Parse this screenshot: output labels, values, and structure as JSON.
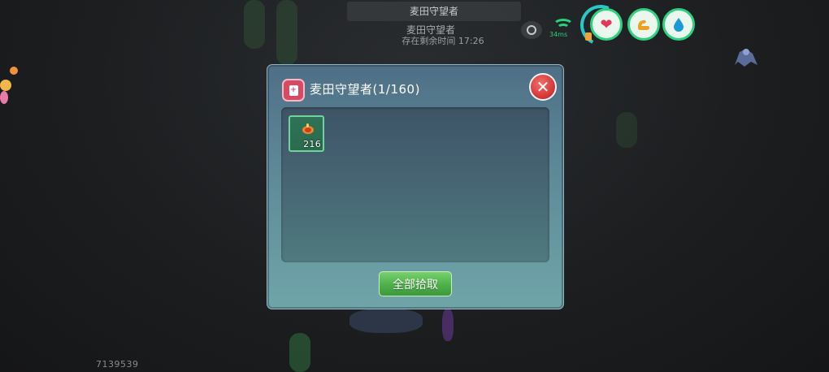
{
  "hud": {
    "top_banner": "麦田守望者",
    "sub_title": "麦田守望者",
    "sub_time": "存在剩余时间 17:26",
    "ping": "34ms",
    "stats": [
      {
        "name": "heart-icon",
        "color": "#e2395a",
        "glyph": "❤"
      },
      {
        "name": "muscle-icon",
        "color": "#f0a020",
        "glyph": "💪"
      },
      {
        "name": "water-drop-icon",
        "color": "#1b9bd6",
        "glyph": "💧"
      }
    ],
    "bottom_number": "7139539"
  },
  "dialog": {
    "title": "麦田守望者(1/160)",
    "close_glyph": "✕",
    "items": [
      {
        "icon": "fruit-icon",
        "count": "216"
      }
    ],
    "pickup_all_label": "全部拾取"
  },
  "colors": {
    "accent_green": "#4db04a",
    "close_red": "#d83a3a",
    "slot_border": "#6fd39b"
  }
}
